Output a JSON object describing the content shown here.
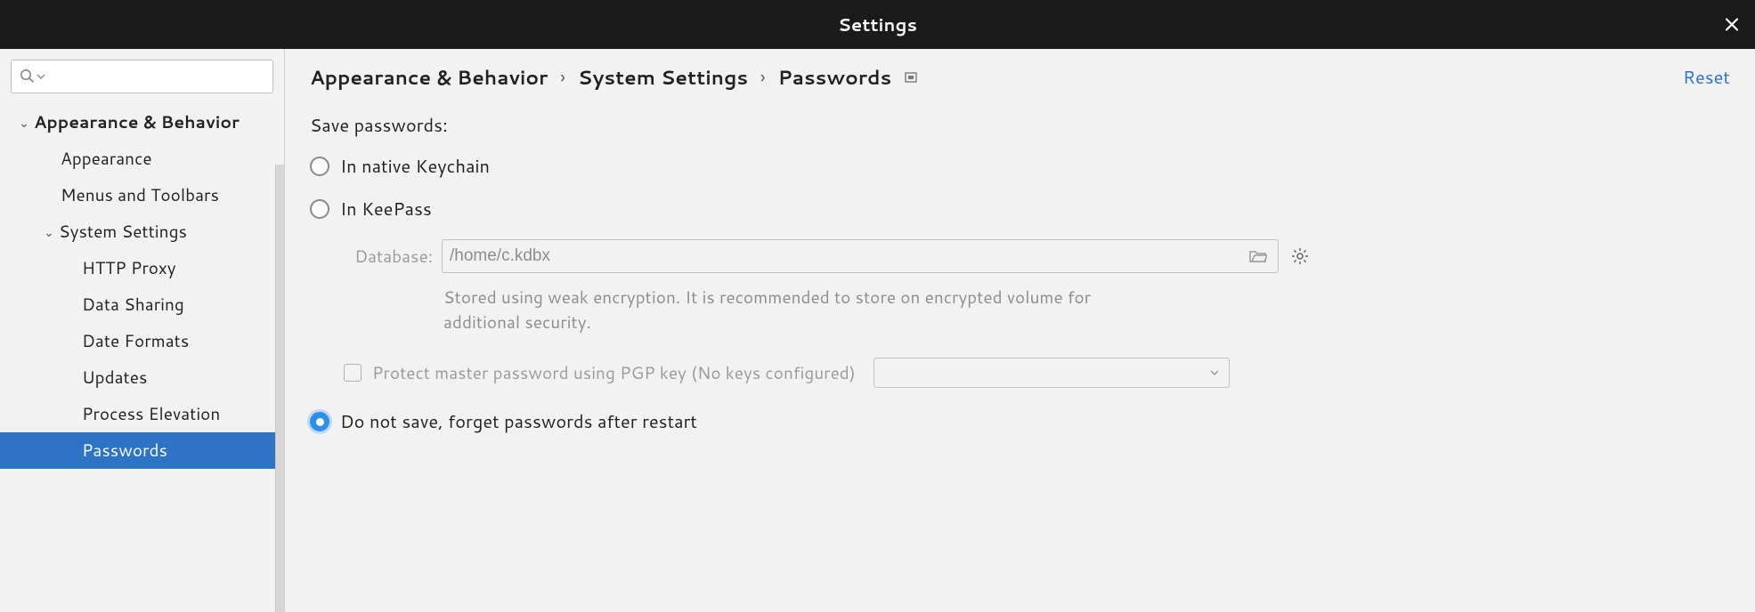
{
  "window": {
    "title": "Settings"
  },
  "sidebar": {
    "search_placeholder": "",
    "items": [
      {
        "label": "Appearance & Behavior",
        "indent": 0,
        "bold": true,
        "expanded": true,
        "hasArrow": true
      },
      {
        "label": "Appearance",
        "indent": 1
      },
      {
        "label": "Menus and Toolbars",
        "indent": 1
      },
      {
        "label": "System Settings",
        "indent": 1,
        "expanded": true,
        "hasArrow": true
      },
      {
        "label": "HTTP Proxy",
        "indent": 2
      },
      {
        "label": "Data Sharing",
        "indent": 2
      },
      {
        "label": "Date Formats",
        "indent": 2
      },
      {
        "label": "Updates",
        "indent": 2
      },
      {
        "label": "Process Elevation",
        "indent": 2
      },
      {
        "label": "Passwords",
        "indent": 2,
        "selected": true
      }
    ]
  },
  "breadcrumb": {
    "part1": "Appearance & Behavior",
    "part2": "System Settings",
    "part3": "Passwords",
    "reset": "Reset"
  },
  "form": {
    "section_label": "Save passwords:",
    "radio_keychain": "In native Keychain",
    "radio_keepass": "In KeePass",
    "db_label": "Database:",
    "db_value": "/home/c.kdbx",
    "hint": "Stored using weak encryption. It is recommended to store on encrypted volume for additional security.",
    "pgp_check": "Protect master password using PGP key (No keys configured)",
    "radio_none": "Do not save, forget passwords after restart",
    "selected": "none"
  }
}
